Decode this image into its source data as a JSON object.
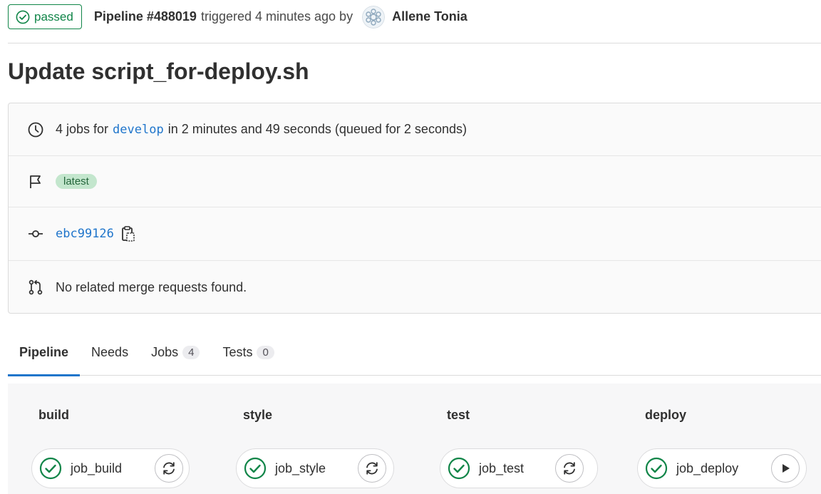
{
  "header": {
    "status": "passed",
    "pipeline": "Pipeline #488019",
    "triggered": "triggered 4 minutes ago by",
    "author": "Allene Tonia"
  },
  "title": "Update script_for-deploy.sh",
  "info": {
    "jobs_prefix": "4 jobs for",
    "branch": "develop",
    "jobs_suffix": "in 2 minutes and 49 seconds (queued for 2 seconds)",
    "label": "latest",
    "commit": "ebc99126",
    "merge_requests": "No related merge requests found."
  },
  "tabs": [
    {
      "label": "Pipeline"
    },
    {
      "label": "Needs"
    },
    {
      "label": "Jobs",
      "count": "4"
    },
    {
      "label": "Tests",
      "count": "0"
    }
  ],
  "stages": [
    {
      "title": "build",
      "job": "job_build",
      "action": "retry-icon"
    },
    {
      "title": "style",
      "job": "job_style",
      "action": "retry-icon"
    },
    {
      "title": "test",
      "job": "job_test",
      "action": "retry-icon"
    },
    {
      "title": "deploy",
      "job": "job_deploy",
      "action": "play-icon"
    }
  ],
  "colors": {
    "success": "#108548",
    "link": "#1f75cb",
    "label_bg": "#c3e6cd"
  }
}
